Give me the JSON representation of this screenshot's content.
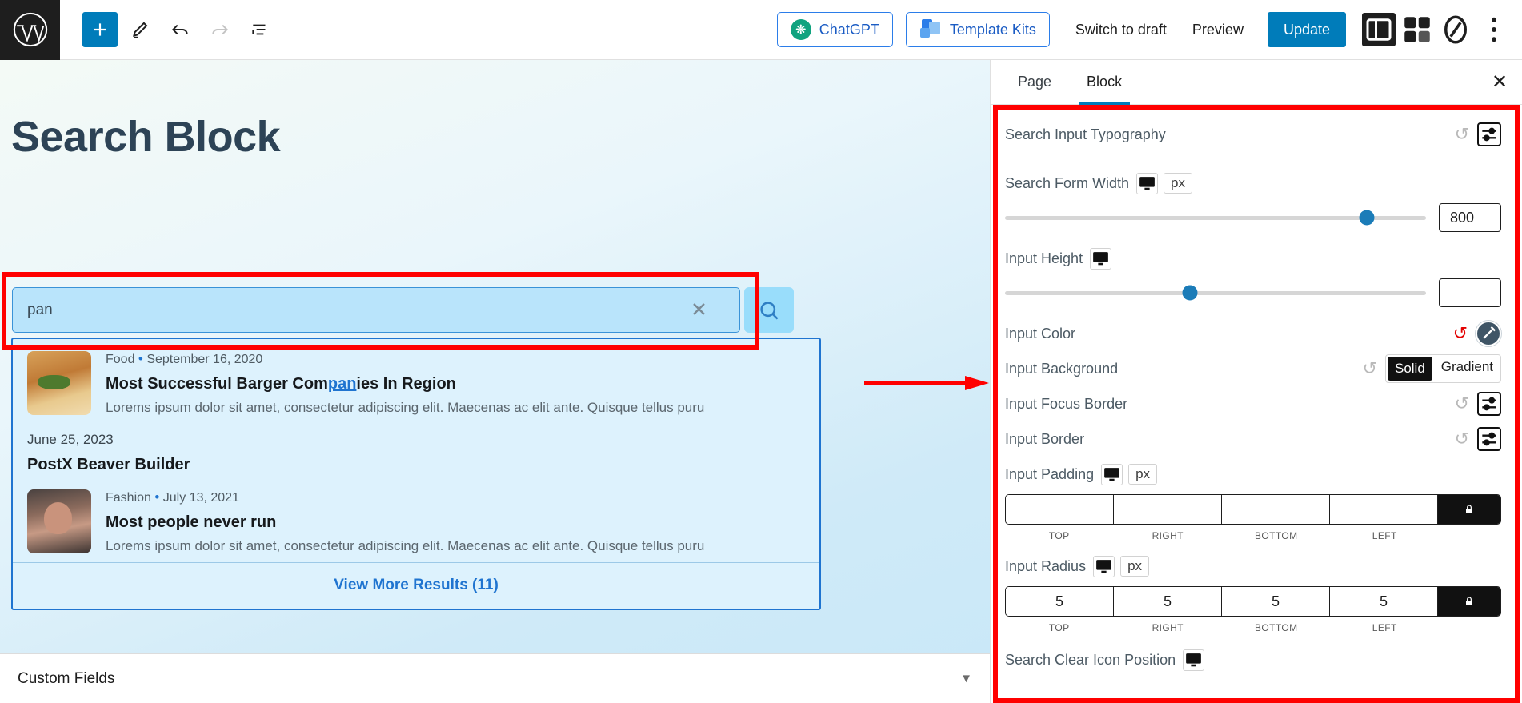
{
  "topbar": {
    "logo_icon": "wordpress-icon",
    "add_block_icon": "plus-icon",
    "edit_icon": "pencil-icon",
    "undo_icon": "undo-arrow-icon",
    "redo_icon": "redo-arrow-icon",
    "list_view_icon": "document-outline-icon",
    "chatgpt_label": "ChatGPT",
    "template_kits_label": "Template Kits",
    "switch_to_draft_label": "Switch to draft",
    "preview_label": "Preview",
    "update_label": "Update",
    "settings_panel_icon": "sidebar-panel-icon",
    "blocks_icon": "stacked-blocks-icon",
    "zero_icon": "zero-slash-icon",
    "more_icon": "vertical-ellipsis-icon"
  },
  "canvas": {
    "page_title": "Search Block",
    "search": {
      "value": "pan",
      "clear_icon": "close-x-icon",
      "submit_icon": "magnifier-icon"
    },
    "results": {
      "items": [
        {
          "category": "Food",
          "separator": "•",
          "date": "September 16, 2020",
          "title_before": "Most Successful Barger Com",
          "title_match": "pan",
          "title_after": "ies In Region",
          "excerpt": "Lorems ipsum dolor sit amet, consectetur adipiscing elit. Maecenas ac elit ante. Quisque tellus puru",
          "thumb": "food-burger-thumbnail"
        }
      ],
      "group_date": "June 25, 2023",
      "group_label": "PostX Beaver Builder",
      "items2": [
        {
          "category": "Fashion",
          "separator": "•",
          "date": "July 13, 2021",
          "title": "Most people never run",
          "excerpt": "Lorems ipsum dolor sit amet, consectetur adipiscing elit. Maecenas ac elit ante. Quisque tellus puru",
          "thumb": "fashion-portrait-thumbnail"
        }
      ],
      "view_more_label": "View More Results (11)"
    },
    "custom_fields_label": "Custom Fields",
    "custom_fields_caret": "▼"
  },
  "sidebar": {
    "tabs": [
      {
        "label": "Page",
        "active": false
      },
      {
        "label": "Block",
        "active": true
      }
    ],
    "close_icon": "close-x-icon",
    "controls": {
      "typography": {
        "label": "Search Input Typography",
        "reset_icon": "reset-circular-arrow-icon",
        "settings_icon": "sliders-icon"
      },
      "form_width": {
        "label": "Search Form Width",
        "device_icon": "desktop-icon",
        "unit": "px",
        "value": "800",
        "slider_percent": 86
      },
      "input_height": {
        "label": "Input Height",
        "device_icon": "desktop-icon",
        "value": "",
        "slider_percent": 44
      },
      "input_color": {
        "label": "Input Color",
        "reset_icon": "reset-circular-arrow-icon",
        "color_icon": "brush-circle-icon"
      },
      "input_background": {
        "label": "Input Background",
        "reset_icon": "reset-circular-arrow-icon",
        "options": [
          "Solid",
          "Gradient"
        ],
        "selected": "Solid"
      },
      "input_focus_border": {
        "label": "Input Focus Border",
        "reset_icon": "reset-circular-arrow-icon",
        "settings_icon": "sliders-icon"
      },
      "input_border": {
        "label": "Input Border",
        "reset_icon": "reset-circular-arrow-icon",
        "settings_icon": "sliders-icon"
      },
      "input_padding": {
        "label": "Input Padding",
        "device_icon": "desktop-icon",
        "unit": "px",
        "values": {
          "top": "",
          "right": "",
          "bottom": "",
          "left": ""
        },
        "side_labels": [
          "TOP",
          "RIGHT",
          "BOTTOM",
          "LEFT"
        ],
        "lock_icon": "lock-icon"
      },
      "input_radius": {
        "label": "Input Radius",
        "device_icon": "desktop-icon",
        "unit": "px",
        "values": {
          "top": "5",
          "right": "5",
          "bottom": "5",
          "left": "5"
        },
        "side_labels": [
          "TOP",
          "RIGHT",
          "BOTTOM",
          "LEFT"
        ],
        "lock_icon": "lock-icon"
      },
      "clear_icon_position": {
        "label": "Search Clear Icon Position",
        "device_icon": "desktop-icon"
      }
    }
  },
  "annotations": {
    "highlight_color": "#ff0000",
    "arrow_icon": "right-arrow-annotation"
  }
}
